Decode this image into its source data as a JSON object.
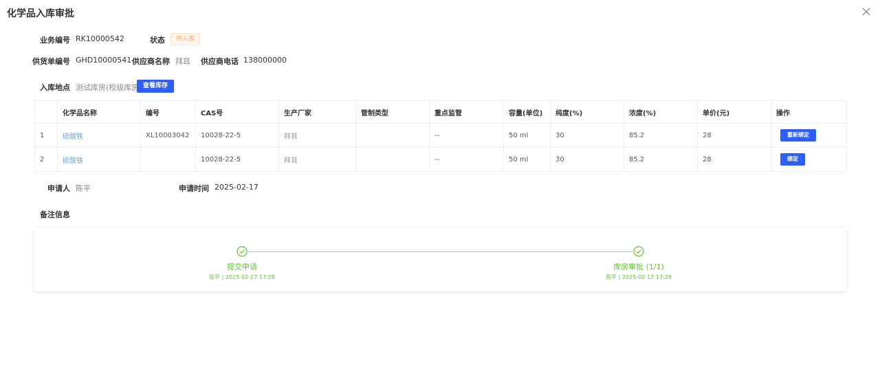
{
  "dialog": {
    "title": "化学品入库审批"
  },
  "info": {
    "business_no_label": "业务编号",
    "business_no": "RK10000542",
    "status_label": "状态",
    "status": "待入库",
    "supply_no_label": "供货单编号",
    "supply_no": "GHD10000541",
    "supplier_label": "供应商名称",
    "supplier": "拜耳",
    "supplier_phone_label": "供应商电话",
    "supplier_phone": "138000000",
    "location_label": "入库地点",
    "location": "测试库房(校级库房)",
    "view_stock_button": "查看库存",
    "applicant_label": "申请人",
    "applicant": "陈平",
    "apply_time_label": "申请时间",
    "apply_time": "2025-02-17",
    "remark_label": "备注信息"
  },
  "table": {
    "headers": [
      "",
      "化学品名称",
      "编号",
      "CAS号",
      "生产厂家",
      "管制类型",
      "重点监管",
      "容量(单位)",
      "纯度(%)",
      "浓度(%)",
      "单价(元)",
      "操作"
    ],
    "rows": [
      {
        "index": "1",
        "name": "硫酸铁",
        "code": "XL10003042",
        "cas": "10028-22-5",
        "maker": "拜耳",
        "control": "",
        "key": "--",
        "capacity": "50 ml",
        "purity": "30",
        "concentration": "85.2",
        "price": "28",
        "action": "重新绑定"
      },
      {
        "index": "2",
        "name": "硫酸铁",
        "code": "",
        "cas": "10028-22-5",
        "maker": "拜耳",
        "control": "",
        "key": "--",
        "capacity": "50 ml",
        "purity": "30",
        "concentration": "85.2",
        "price": "28",
        "action": "绑定"
      }
    ]
  },
  "steps": [
    {
      "title": "提交申请",
      "sub": "陈平 | 2025-02-17 17:28"
    },
    {
      "title": "库房审批 (1/1)",
      "sub": "陈平 | 2025-02-17 17:28"
    }
  ],
  "colors": {
    "primary": "#2f5ef5",
    "success": "#67c23a",
    "link": "#6ea5e0",
    "warning": "#f5b27a"
  },
  "icons": {
    "close": "close-icon",
    "step_done": "check-circle-icon"
  }
}
